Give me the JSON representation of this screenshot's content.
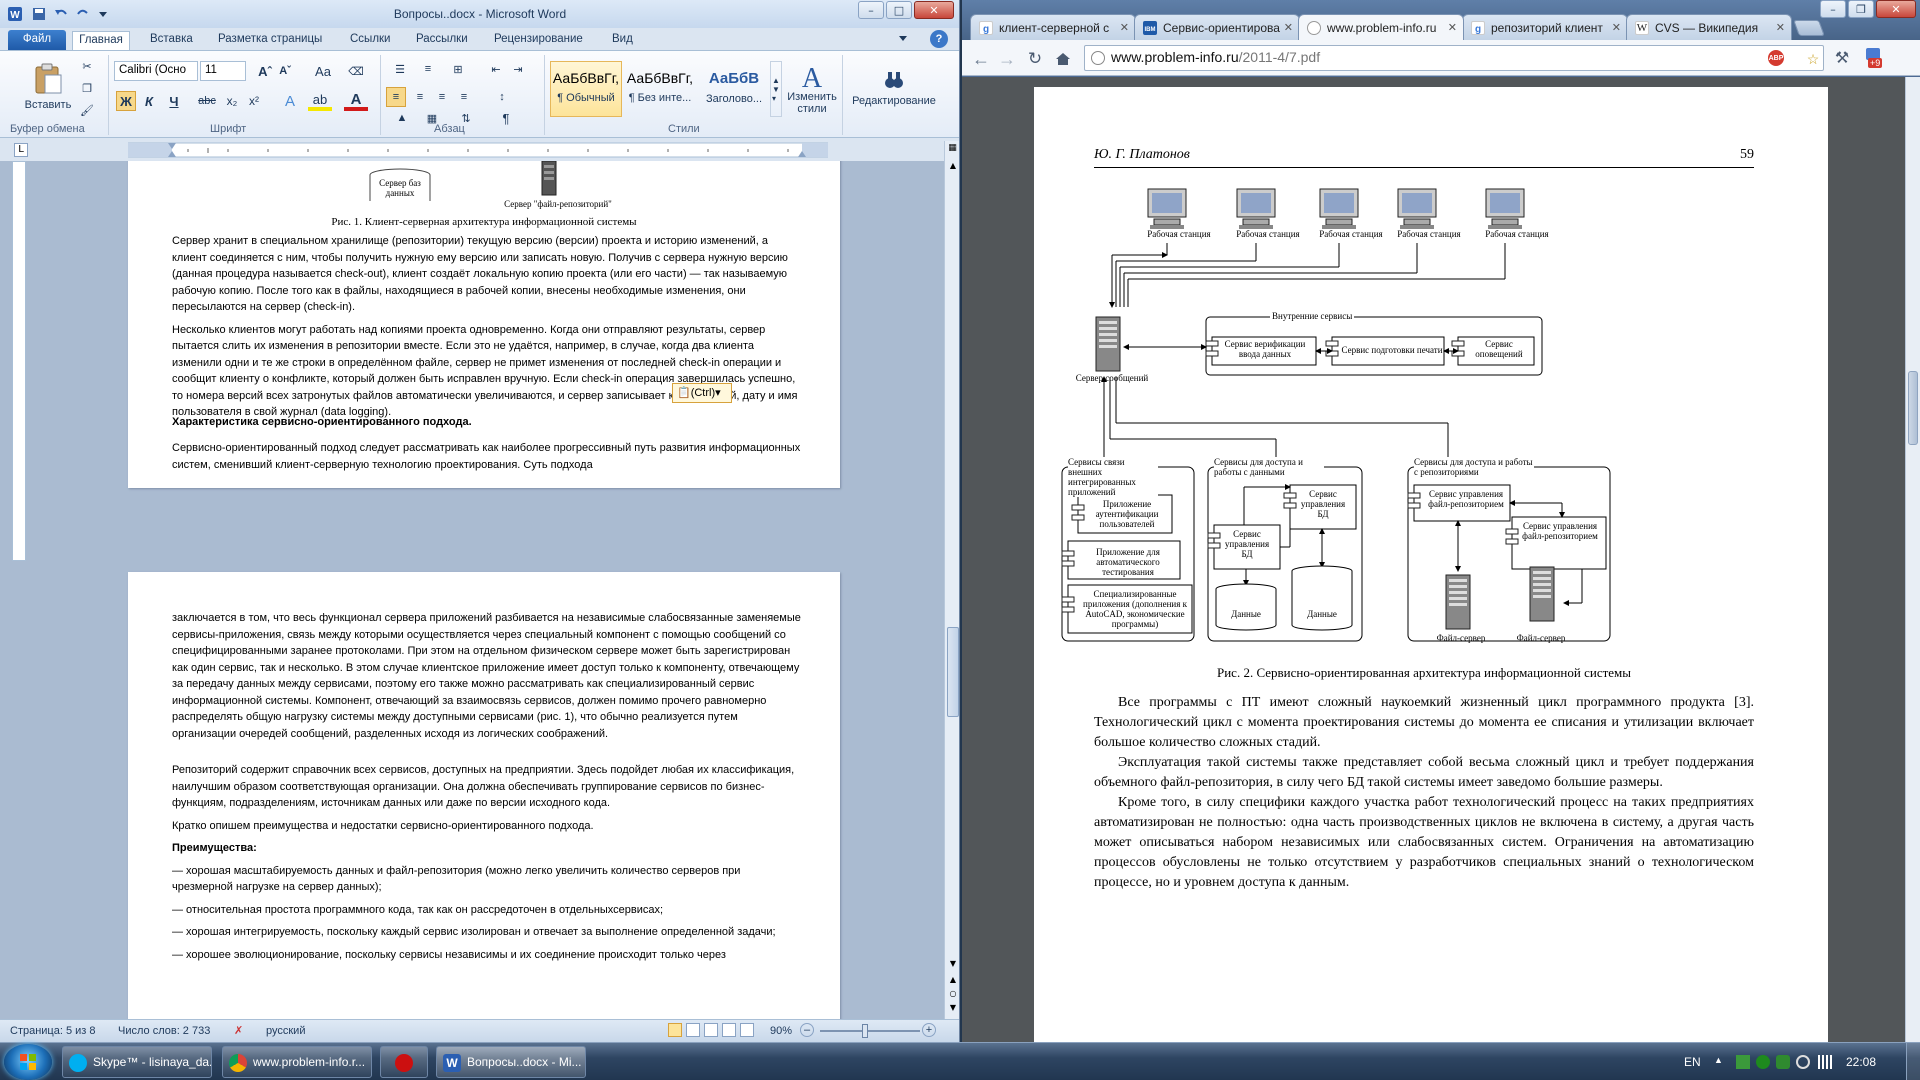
{
  "word": {
    "title": "Вопросы..docx - Microsoft Word",
    "tabs": [
      "Файл",
      "Главная",
      "Вставка",
      "Разметка страницы",
      "Ссылки",
      "Рассылки",
      "Рецензирование",
      "Вид"
    ],
    "ribbon": {
      "paste_label": "Вставить",
      "font_name": "Calibri (Осно",
      "font_size": "11",
      "styles": [
        {
          "sample": "АаБбВвГг,",
          "name": "¶ Обычный"
        },
        {
          "sample": "АаБбВвГг,",
          "name": "¶ Без инте..."
        },
        {
          "sample": "АаБбВ",
          "name": "Заголово..."
        }
      ],
      "change_styles_label": "Изменить стили",
      "editing_label": "Редактирование",
      "groups": [
        "Буфер обмена",
        "Шрифт",
        "Абзац",
        "Стили"
      ]
    },
    "page1": {
      "fig_label_db": "Сервер баз данных",
      "fig_label_repo": "Сервер \"файл-репозиторий\"",
      "fig_caption": "Рис. 1. Клиент-серверная архитектура информационной системы",
      "para1": "Сервер хранит в специальном хранилище (репозитории) текущую версию (версии) проекта и историю изменений, а клиент соединяется с ним, чтобы получить нужную ему версию или записать новую. Получив с сервера нужную версию (данная процедура называется check-out), клиент создаёт локальную копию проекта (или его части) — так называемую рабочую копию. После того как в файлы, находящиеся в рабочей копии, внесены необходимые изменения, они пересылаются на сервер (check-in).",
      "para2": "Несколько клиентов могут работать над копиями проекта одновременно. Когда они отправляют результаты, сервер пытается слить их изменения в репозитории вместе. Если это не удаётся, например, в случае, когда два клиента изменили одни и те же строки в определённом файле, сервер не примет изменения от последней check-in операции и сообщит клиенту о конфликте, который должен быть исправлен вручную. Если check-in операция завершилась успешно, то номера версий всех затронутых файлов автоматически увеличиваются, и сервер записывает комментарий, дату и имя пользователя в свой журнал (data logging).",
      "paste_tag": "(Ctrl)",
      "heading": "Характеристика сервисно-ориентированного подхода.",
      "para3": "Сервисно-ориентированный подход следует рассматривать как наиболее прогрессивный путь развития информационных систем, сменивший клиент-серверную технологию проектирования. Суть подхода"
    },
    "page2": {
      "para1": "заключается в том, что весь функционал сервера приложений разбивается на независимые слабосвязанные заменяемые сервисы-приложения, связь между которыми осуществляется через специальный компонент с помощью сообщений со специфицированными заранее протоколами. При этом на отдельном физическом сервере может быть зарегистрирован как один сервис, так и несколько. В этом случае клиентское приложение имеет доступ только к компоненту, отвечающему за передачу данных между сервисами, поэтому его также можно рассматривать как специализированный сервис информационной системы. Компонент, отвечающий за взаимосвязь сервисов, должен помимо прочего равномерно распределять общую нагрузку системы между доступными сервисами (рис. 1), что обычно реализуется путем организации очередей сообщений, разделенных исходя из логических соображений.",
      "para2": "Репозиторий содержит справочник всех сервисов, доступных на предприятии. Здесь подойдет любая их классификация, наилучшим образом соответствующая организации. Она должна обеспечивать группирование сервисов по бизнес-функциям, подразделениям, источникам данных или даже по версии исходного кода.",
      "para3": "Кратко опишем преимущества и недостатки сервисно-ориентированного подхода.",
      "heading": "Преимущества:",
      "item1": "— хорошая масштабируемость данных и файл-репозитория (можно легко увеличить количество серверов при чрезмерной нагрузке на сервер данных);",
      "item2": "— относительная простота программного кода, так как он рассредоточен в отдельныхсервисах;",
      "item3": "— хорошая интегрируемость, поскольку каждый сервис изолирован и отвечает за выполнение определенной задачи;",
      "item4": "— хорошее эволюционирование, поскольку сервисы независимы и их соединение происходит только через"
    },
    "status": {
      "page": "Страница: 5 из 8",
      "words": "Число слов: 2 733",
      "lang": "русский",
      "zoom": "90%"
    }
  },
  "chrome": {
    "tabs": [
      {
        "label": "клиент-серверной с",
        "fav": "google"
      },
      {
        "label": "Сервис-ориентирова",
        "fav": "ibm"
      },
      {
        "label": "www.problem-info.ru",
        "fav": "page",
        "active": true
      },
      {
        "label": "репозиторий клиент",
        "fav": "google"
      },
      {
        "label": "CVS — Википедия",
        "fav": "wiki"
      }
    ],
    "url_host": "www.problem-info.ru",
    "url_path": "/2011-4/7.pdf",
    "badge": "+9",
    "pdf": {
      "header_left": "Ю. Г. Платонов",
      "header_right": "59",
      "workstation": "Рабочая станция",
      "internal_services": "Внутренние сервисы",
      "svc_verify": "Сервис верификации ввода данных",
      "svc_print": "Сервис подготовки печати",
      "svc_notify": "Сервис оповещений",
      "msg_server": "Сервер сообщений",
      "ext_services": "Сервисы связи внешних интегрированных приложений",
      "app_auth": "Приложение аутентификации пользователей",
      "app_test": "Приложение для автоматического тестирования",
      "app_spec": "Специализированные приложения (дополнения к AutoCAD, экономические программы)",
      "data_services": "Сервисы для доступа и работы с данными",
      "db_mgmt": "Сервис управления БД",
      "data": "Данные",
      "repo_services": "Сервисы для доступа и работы с репозиториями",
      "file_repo_mgmt": "Сервис управления файл-репозиторием",
      "file_server": "Файл-сервер",
      "fig_caption": "Рис. 2. Сервисно-ориентированная архитектура информационной системы",
      "para1": "Все программы с ПТ имеют сложный наукоемкий жизненный цикл программного продукта [3]. Технологический цикл с момента проектирования системы до момента ее списания и утилизации включает большое количество сложных стадий.",
      "para2": "Эксплуатация такой системы также представляет собой весьма сложный цикл и требует поддержания объемного файл-репозитория, в силу чего БД такой системы имеет заведомо большие размеры.",
      "para3": "Кроме того, в силу специфики каждого участка работ технологический процесс на таких предприятиях автоматизирован не полностью: одна часть производственных циклов не включена в систему, а другая часть может описываться набором независимых или слабосвязанных систем. Ограничения на автоматизацию процессов обусловлены не только отсутствием у разработчиков специальных знаний о технологическом процессе, но и уровнем доступа к данным."
    }
  },
  "taskbar": {
    "items": [
      {
        "label": "Skype™ - lisinaya_da...",
        "icon": "skype-icon"
      },
      {
        "label": "www.problem-info.r...",
        "icon": "chrome-icon"
      },
      {
        "label": "",
        "icon": "opera-icon"
      },
      {
        "label": "Вопросы..docx - Mi...",
        "icon": "word-icon"
      }
    ],
    "lang": "EN",
    "time": "22:08"
  }
}
